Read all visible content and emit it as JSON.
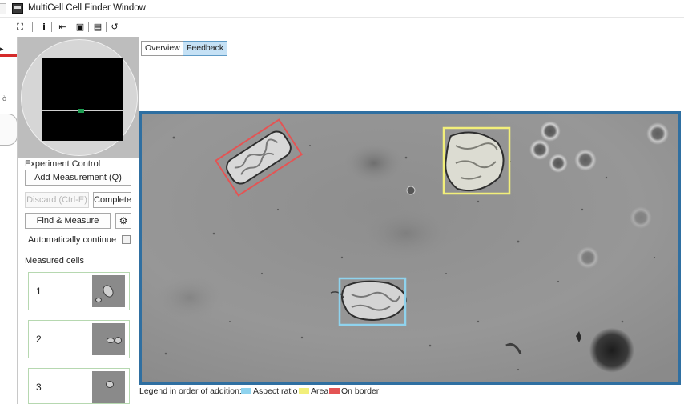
{
  "window": {
    "title": "MultiCell Cell Finder Window"
  },
  "toolbar": {
    "buttons": [
      {
        "icon": "screen-select-icon",
        "glyph": "⛶"
      },
      {
        "icon": "info-icon",
        "glyph": "i"
      },
      {
        "icon": "pin-icon",
        "glyph": "⇤"
      },
      {
        "icon": "save-image-icon",
        "glyph": "▣"
      },
      {
        "icon": "export-image-icon",
        "glyph": "▤"
      },
      {
        "icon": "undo-icon",
        "glyph": "↺"
      }
    ]
  },
  "tabs": [
    {
      "label": "Overview",
      "active": false
    },
    {
      "label": "Feedback",
      "active": true
    }
  ],
  "experiment_control": {
    "heading": "Experiment Control",
    "add_measurement": "Add Measurement (Q)",
    "discard": "Discard (Ctrl-E)",
    "complete": "Complete",
    "find_measure": "Find & Measure",
    "settings_icon": "gear-icon",
    "auto_continue_label": "Automatically continue",
    "auto_continue_checked": false
  },
  "measured_cells": {
    "heading": "Measured cells",
    "items": [
      {
        "number": "1"
      },
      {
        "number": "2"
      },
      {
        "number": "3"
      }
    ]
  },
  "legend": {
    "prefix": "Legend in order of addition:",
    "items": [
      {
        "label": "Aspect ratio",
        "color": "#8fd3ee"
      },
      {
        "label": "Area",
        "color": "#f2ef7a"
      },
      {
        "label": "On border",
        "color": "#e45454"
      }
    ]
  },
  "detections": [
    {
      "criterion": "On border",
      "color": "#e45454"
    },
    {
      "criterion": "Area",
      "color": "#f2ef7a"
    },
    {
      "criterion": "Aspect ratio",
      "color": "#8fd3ee"
    }
  ],
  "colors": {
    "frame_border": "#2f6fa1",
    "active_tab": "#c5e1f5",
    "card_border": "#b6d8b0",
    "navigator_marker": "#1f9e53"
  }
}
